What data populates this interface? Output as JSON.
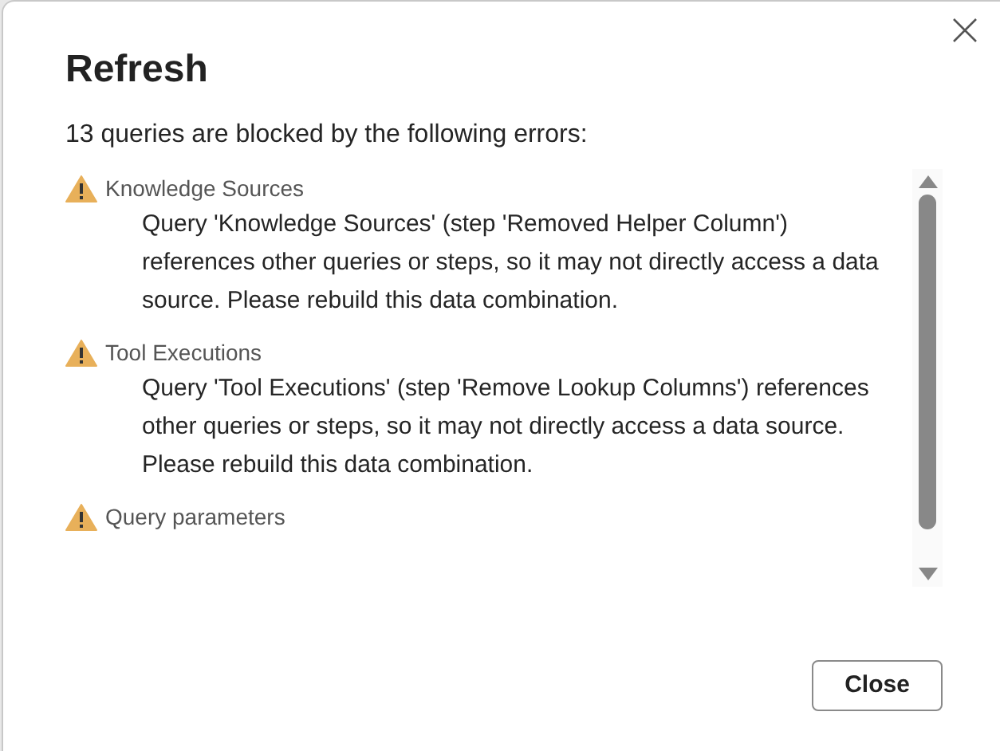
{
  "dialog": {
    "title": "Refresh",
    "message": "13 queries are blocked by the following errors:",
    "errors": [
      {
        "name": "Knowledge Sources",
        "detail": "Query 'Knowledge Sources' (step 'Removed Helper Column') references other queries or steps, so it may not directly access a data source. Please rebuild this data combination."
      },
      {
        "name": "Tool Executions",
        "detail": "Query 'Tool Executions' (step 'Remove Lookup Columns') references other queries or steps, so it may not directly access a data source. Please rebuild this data combination."
      },
      {
        "name": "Query parameters"
      }
    ],
    "buttons": [
      "Close"
    ]
  }
}
